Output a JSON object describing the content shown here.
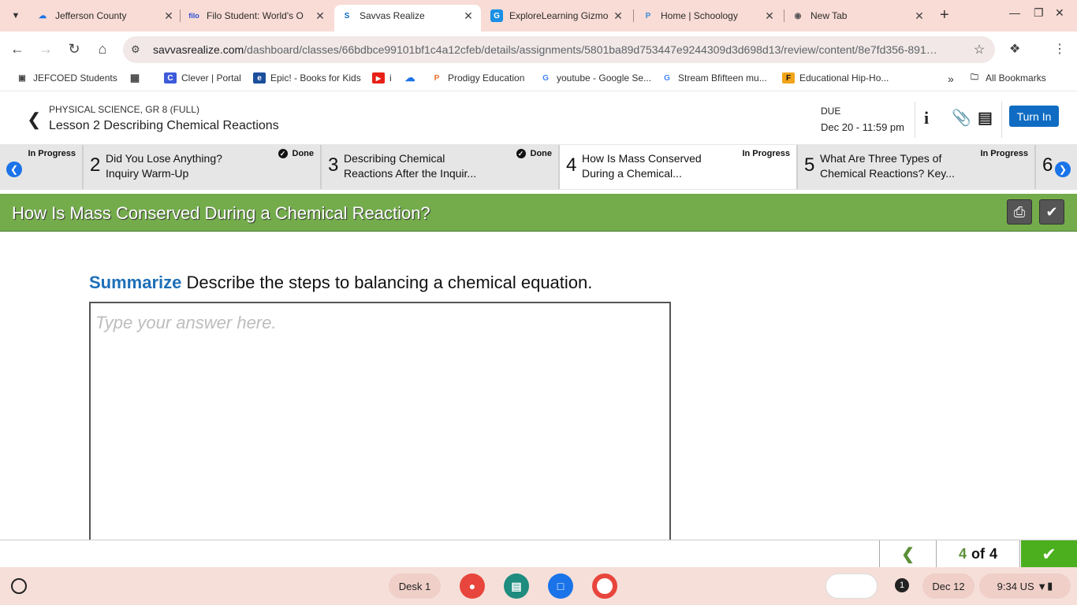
{
  "browser": {
    "tabs": [
      {
        "title": "Jefferson County",
        "icon": "onedrive-icon",
        "active": false
      },
      {
        "title": "Filo Student: World's O",
        "icon": "filo-icon",
        "active": false
      },
      {
        "title": "Savvas Realize",
        "icon": "savvas-icon",
        "active": true
      },
      {
        "title": "ExploreLearning Gizmo",
        "icon": "gizmos-icon",
        "active": false
      },
      {
        "title": "Home | Schoology",
        "icon": "schoology-icon",
        "active": false
      },
      {
        "title": "New Tab",
        "icon": "chrome-icon",
        "active": false
      }
    ],
    "url_host": "savvasrealize.com",
    "url_path": "/dashboard/classes/66bdbce99101bf1c4a12cfeb/details/assignments/5801ba89d753447e9244309d3d698d13/review/content/8e7fd356-891…",
    "bookmarks": [
      "JEFCOED Students",
      "Clever | Portal",
      "Epic! - Books for Kids",
      "i",
      "Prodigy Education",
      "youtube - Google Se...",
      "Stream Bfifteen mu...",
      "Educational Hip-Ho..."
    ],
    "all_bookmarks": "All Bookmarks"
  },
  "header": {
    "course": "PHYSICAL SCIENCE, GR 8 (FULL)",
    "lesson": "Lesson 2 Describing Chemical Reactions",
    "due_label": "DUE",
    "due_value": "Dec 20 - 11:59 pm",
    "turn_in": "Turn In"
  },
  "steps": [
    {
      "num": "",
      "title": "",
      "status": "In Progress",
      "status_done": false
    },
    {
      "num": "2",
      "title1": "Did You Lose Anything?",
      "title2": "Inquiry Warm-Up",
      "status": "Done",
      "status_done": true
    },
    {
      "num": "3",
      "title1": "Describing Chemical",
      "title2": "Reactions After the Inquir...",
      "status": "Done",
      "status_done": true
    },
    {
      "num": "4",
      "title1": "How Is Mass Conserved",
      "title2": "During a Chemical...",
      "status": "In Progress",
      "status_done": false
    },
    {
      "num": "5",
      "title1": "What Are Three Types of",
      "title2": "Chemical Reactions? Key...",
      "status": "In Progress",
      "status_done": false
    },
    {
      "num": "6"
    }
  ],
  "content": {
    "section_title": "How Is Mass Conserved During a Chemical Reaction?",
    "prompt_keyword": "Summarize",
    "prompt_text": "Describe the steps to balancing a chemical equation.",
    "answer_placeholder": "Type your answer here."
  },
  "pager": {
    "current": "4",
    "of": "of",
    "total": "4"
  },
  "shelf": {
    "desk": "Desk 1",
    "notification_count": "1",
    "date": "Dec 12",
    "time": "9:34",
    "locale": "US"
  },
  "colors": {
    "green_bar": "#74ac4c",
    "turn_in_blue": "#0f6cc2",
    "keyword_blue": "#1d6fb8",
    "next_green": "#4caf1e"
  }
}
